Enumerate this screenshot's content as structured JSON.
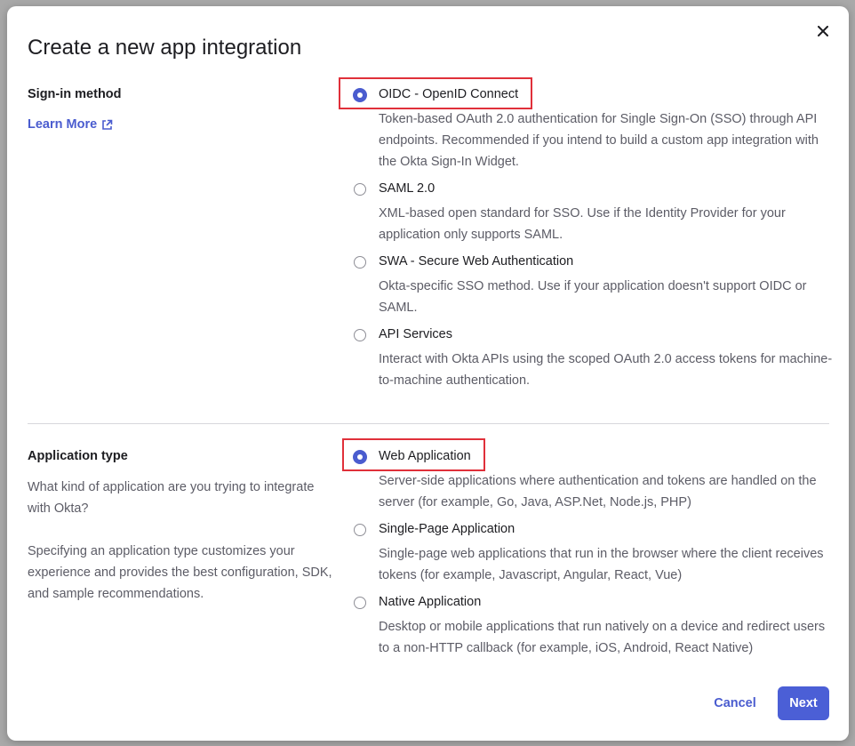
{
  "dialog": {
    "title": "Create a new app integration"
  },
  "sign_in": {
    "label": "Sign-in method",
    "learn_more": "Learn More",
    "options": [
      {
        "label": "OIDC - OpenID Connect",
        "description": "Token-based OAuth 2.0 authentication for Single Sign-On (SSO) through API endpoints. Recommended if you intend to build a custom app integration with the Okta Sign-In Widget.",
        "selected": true
      },
      {
        "label": "SAML 2.0",
        "description": "XML-based open standard for SSO. Use if the Identity Provider for your application only supports SAML.",
        "selected": false
      },
      {
        "label": "SWA - Secure Web Authentication",
        "description": "Okta-specific SSO method. Use if your application doesn't support OIDC or SAML.",
        "selected": false
      },
      {
        "label": "API Services",
        "description": "Interact with Okta APIs using the scoped OAuth 2.0 access tokens for machine-to-machine authentication.",
        "selected": false
      }
    ]
  },
  "app_type": {
    "label": "Application type",
    "description_1": "What kind of application are you trying to integrate with Okta?",
    "description_2": "Specifying an application type customizes your experience and provides the best configuration, SDK, and sample recommendations.",
    "options": [
      {
        "label": "Web Application",
        "description": "Server-side applications where authentication and tokens are handled on the server (for example, Go, Java, ASP.Net, Node.js, PHP)",
        "selected": true
      },
      {
        "label": "Single-Page Application",
        "description": "Single-page web applications that run in the browser where the client receives tokens (for example, Javascript, Angular, React, Vue)",
        "selected": false
      },
      {
        "label": "Native Application",
        "description": "Desktop or mobile applications that run natively on a device and redirect users to a non-HTTP callback (for example, iOS, Android, React Native)",
        "selected": false
      }
    ]
  },
  "footer": {
    "cancel": "Cancel",
    "next": "Next"
  },
  "colors": {
    "accent": "#4a5ccf",
    "highlight": "#e0303a"
  }
}
